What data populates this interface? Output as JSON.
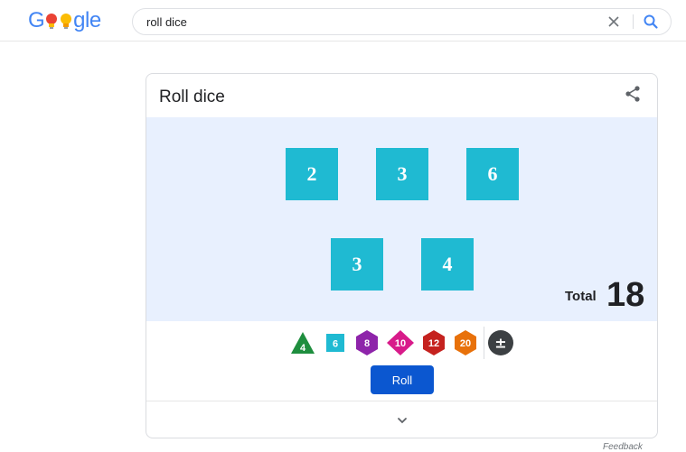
{
  "header": {
    "logo_parts": [
      "G",
      "gle"
    ],
    "search": {
      "value": "roll dice"
    },
    "icons": {
      "clear": "close-icon",
      "search": "search-icon"
    }
  },
  "card": {
    "title": "Roll dice",
    "share_icon": "share-icon",
    "dice": [
      "2",
      "3",
      "6",
      "3",
      "4"
    ],
    "total_label": "Total",
    "total_value": "18",
    "die_types": [
      {
        "label": "4",
        "shape": "triangle",
        "color": "#1e8e3e"
      },
      {
        "label": "6",
        "shape": "square",
        "color": "#1fbad2"
      },
      {
        "label": "8",
        "shape": "hexagon",
        "color": "#8e24aa"
      },
      {
        "label": "10",
        "shape": "diamond",
        "color": "#d81b8a"
      },
      {
        "label": "12",
        "shape": "hexagon",
        "color": "#c5221f"
      },
      {
        "label": "20",
        "shape": "hexagon",
        "color": "#e8710a"
      },
      {
        "label": "±",
        "shape": "circle",
        "color": "#3c4043"
      }
    ],
    "roll_label": "Roll",
    "expand_icon": "chevron-down-icon"
  },
  "feedback_label": "Feedback",
  "colors": {
    "dice_bg": "#1fbad2",
    "area_bg": "#e8f0fe",
    "roll_button": "#0b57d0"
  }
}
